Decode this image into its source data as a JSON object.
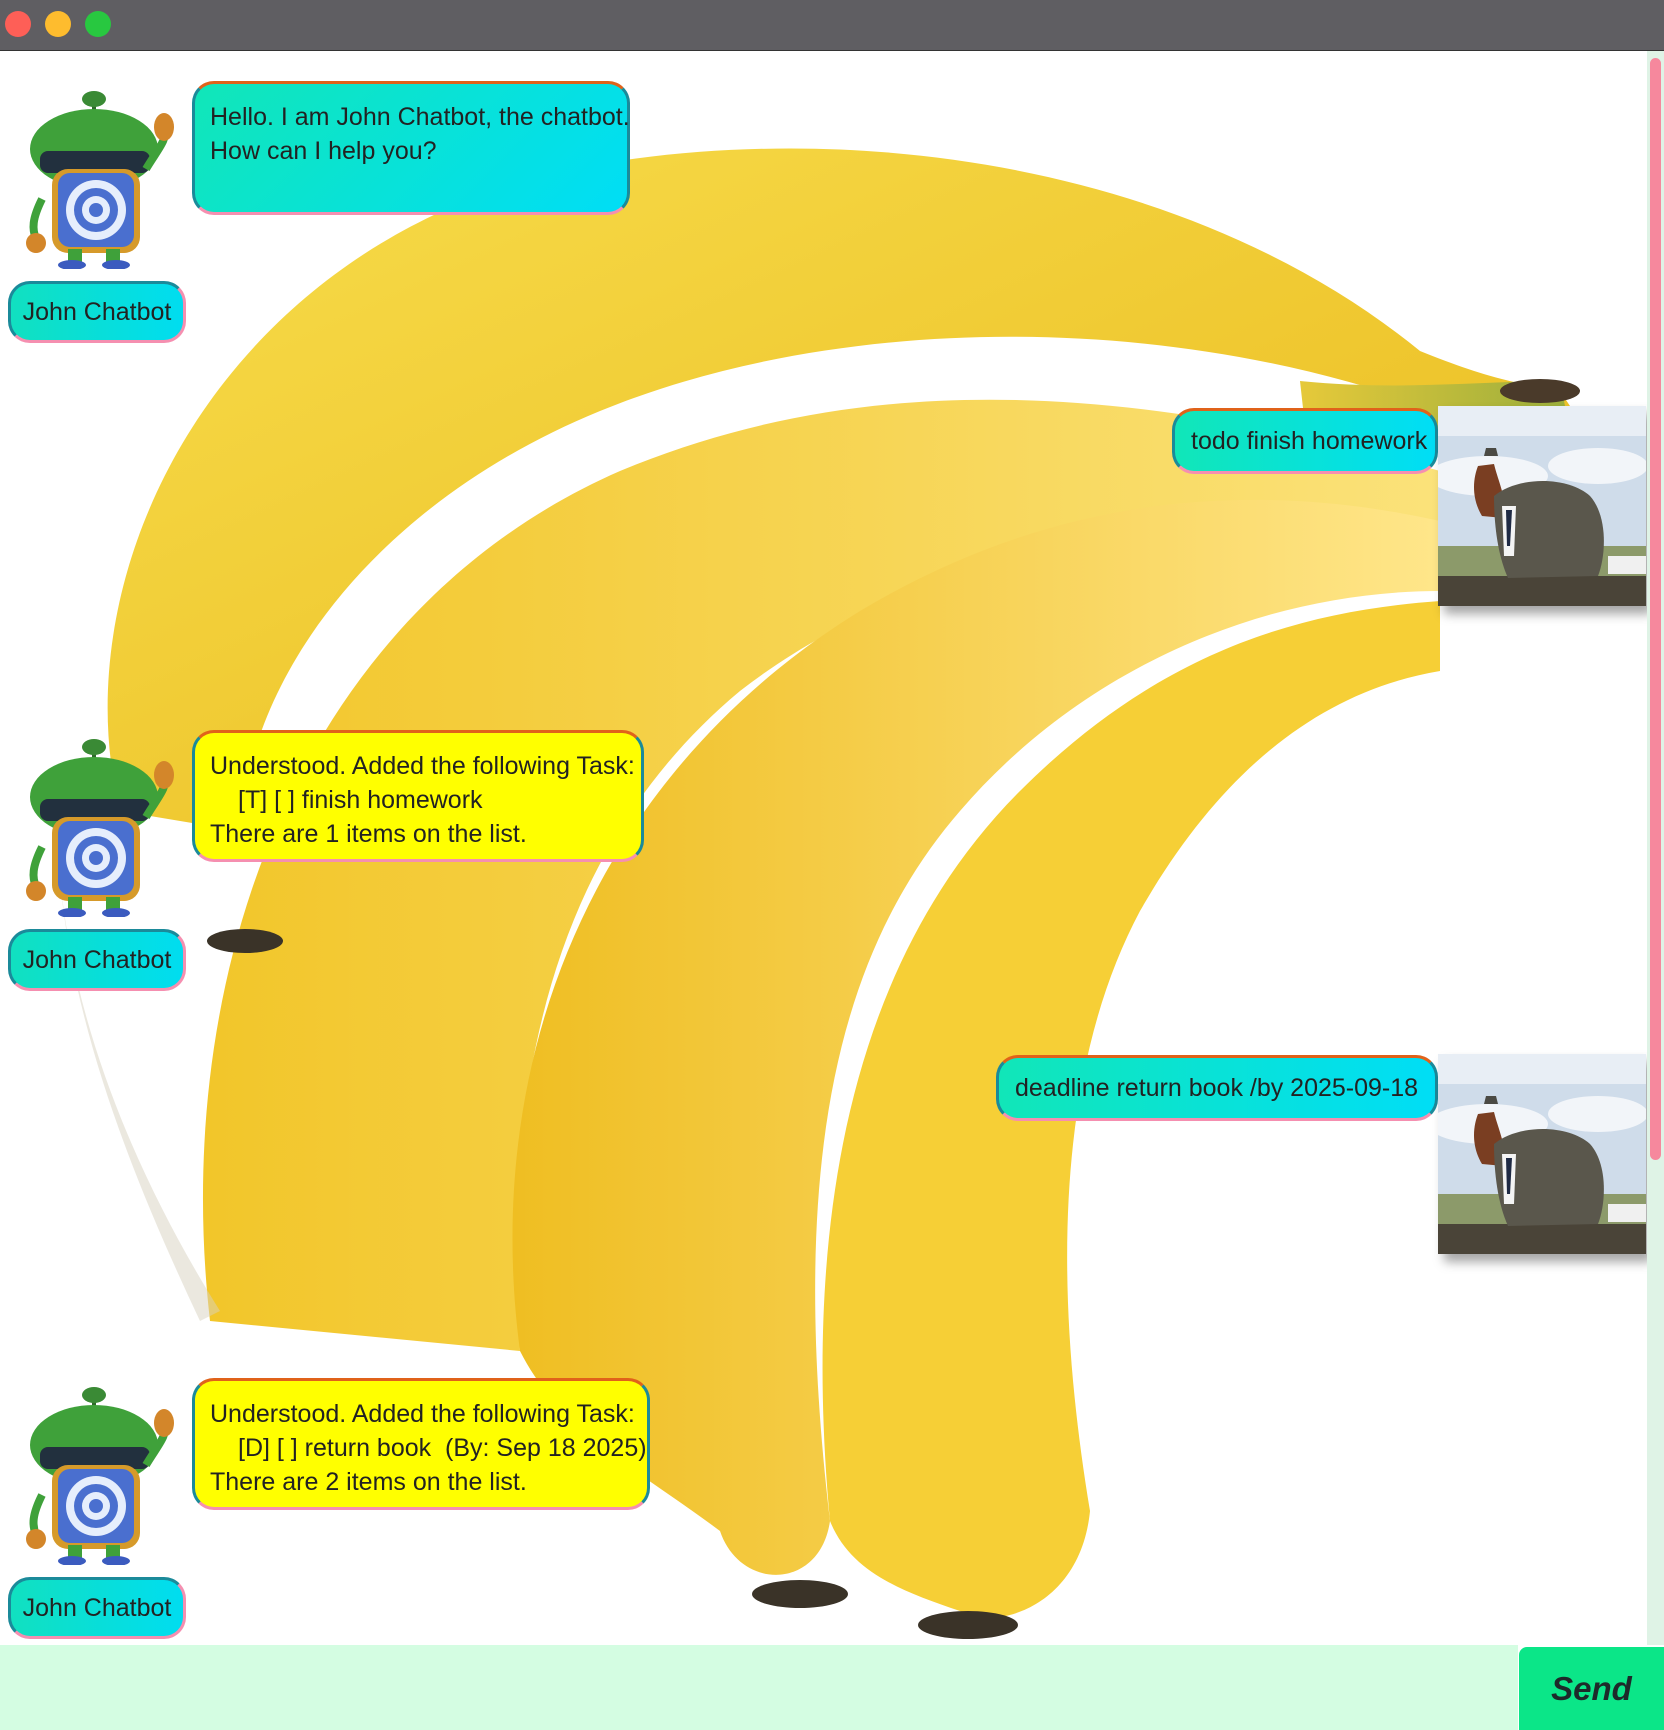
{
  "window": {
    "controls": [
      "close",
      "minimize",
      "maximize"
    ]
  },
  "theme": {
    "bot_bubble_welcome": "#00def6",
    "bot_bubble_task": "#ffff00",
    "input_background": "#d4fde2",
    "send_button": "#0be688",
    "scrollbar_thumb": "#f6889d"
  },
  "messages": [
    {
      "sender": "bot",
      "name": "John Chatbot",
      "avatar": "robot-icon",
      "lines": [
        "Hello. I am John Chatbot, the chatbot.",
        "How can I help you?"
      ]
    },
    {
      "sender": "user",
      "avatar": "horse-in-suit-photo",
      "text": "todo finish homework"
    },
    {
      "sender": "bot",
      "name": "John Chatbot",
      "avatar": "robot-icon",
      "lines": [
        "Understood. Added the following Task:",
        "[T] [ ] finish homework",
        "There are 1 items on the list."
      ]
    },
    {
      "sender": "user",
      "avatar": "horse-in-suit-photo",
      "text": "deadline return book /by 2025-09-18"
    },
    {
      "sender": "bot",
      "name": "John Chatbot",
      "avatar": "robot-icon",
      "lines": [
        "Understood. Added the following Task:",
        "[D] [ ] return book  (By: Sep 18 2025)",
        "There are 2 items on the list."
      ]
    }
  ],
  "input": {
    "value": "",
    "placeholder": ""
  },
  "send_button": {
    "label": "Send"
  }
}
